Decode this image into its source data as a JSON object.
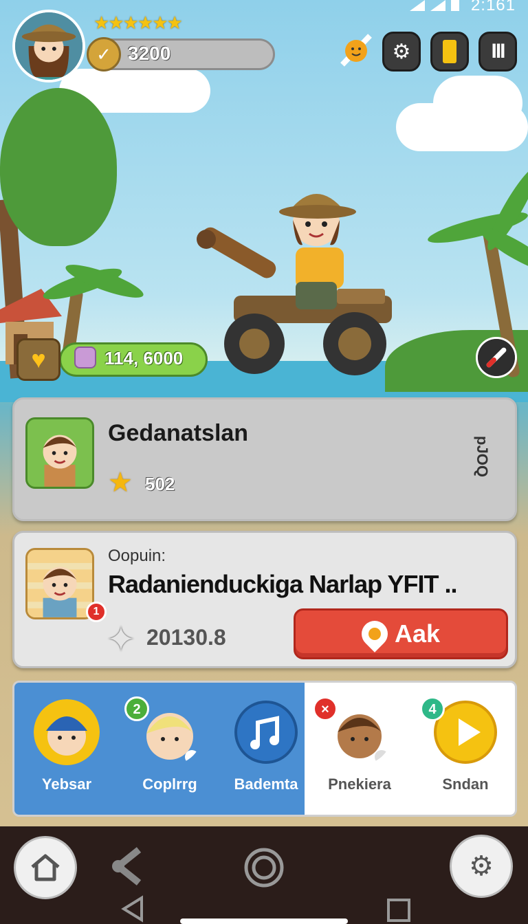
{
  "status_bar": {
    "time": "2:161"
  },
  "hud": {
    "stars": "★★★★★★",
    "coins": "3200",
    "coin_icon": "check-coin-icon",
    "buttons": [
      "settings-icon",
      "card-icon",
      "pause-icon"
    ]
  },
  "health": {
    "value": "114, 6000",
    "icon": "heart-icon"
  },
  "card1": {
    "name": "Gedanatslan",
    "score": "502",
    "side_text": "pJOQ"
  },
  "card2": {
    "label": "Oopuin:",
    "title": "Radanienduckiga Narlap YFIT ..",
    "value": "20130.8",
    "badge": "1",
    "button_label": "Aak"
  },
  "friends": [
    {
      "name": "Yebsar",
      "badge": ""
    },
    {
      "name": "Coplrrg",
      "badge": "2"
    },
    {
      "name": "Bademta",
      "badge": ""
    },
    {
      "name": "Pnekiera",
      "badge": "×"
    },
    {
      "name": "Sndan",
      "badge": "4"
    }
  ],
  "colors": {
    "accent_red": "#e44b3a",
    "health_green": "#8ad24a",
    "friends_blue": "#4b8fd3"
  }
}
